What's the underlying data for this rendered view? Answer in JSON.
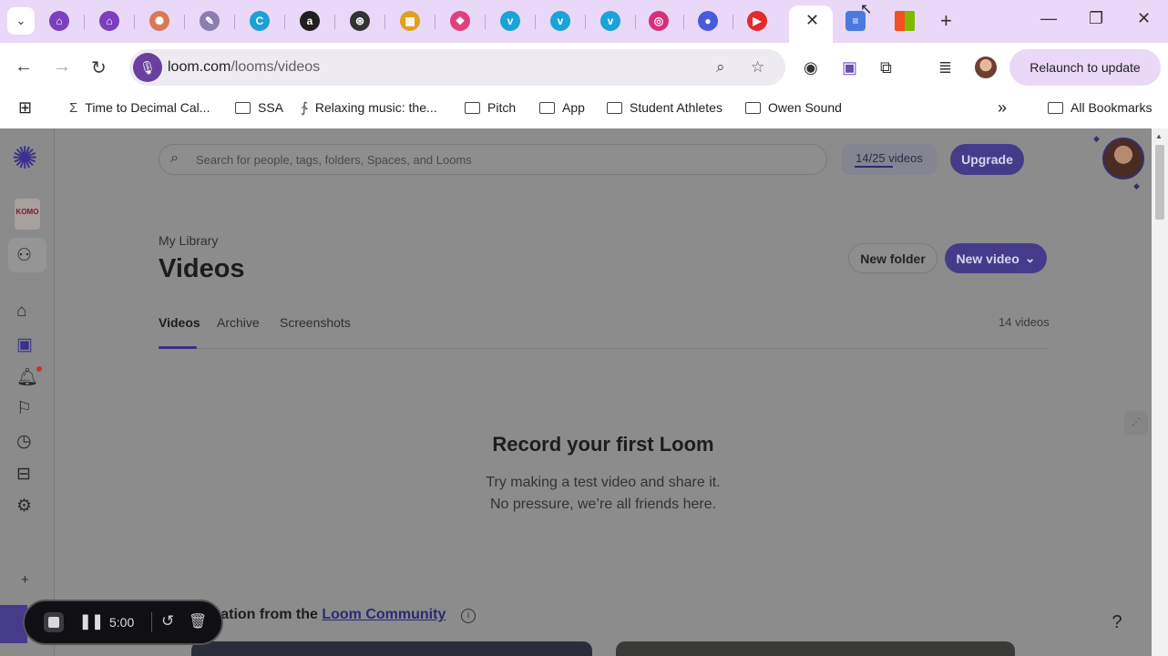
{
  "browser": {
    "tab_favicons": [
      {
        "name": "tab-favicon-1",
        "glyph": "⌂",
        "color": "#7b3fc0"
      },
      {
        "name": "tab-favicon-2",
        "glyph": "⌂",
        "color": "#7b3fc0"
      },
      {
        "name": "tab-favicon-claude",
        "glyph": "✺",
        "color": "#d97a55"
      },
      {
        "name": "tab-favicon-4",
        "glyph": "✎",
        "color": "#8a7fb0"
      },
      {
        "name": "tab-favicon-canva",
        "glyph": "C",
        "color": "#1ba0d8"
      },
      {
        "name": "tab-favicon-amazon",
        "glyph": "a",
        "color": "#1f1f1f"
      },
      {
        "name": "tab-favicon-chatgpt",
        "glyph": "⊛",
        "color": "#333333"
      },
      {
        "name": "tab-favicon-8",
        "glyph": "▦",
        "color": "#e0a020"
      },
      {
        "name": "tab-favicon-9",
        "glyph": "❖",
        "color": "#e04080"
      },
      {
        "name": "tab-favicon-vimeo-1",
        "glyph": "v",
        "color": "#19a3d8"
      },
      {
        "name": "tab-favicon-vimeo-2",
        "glyph": "v",
        "color": "#19a3d8"
      },
      {
        "name": "tab-favicon-vimeo-3",
        "glyph": "v",
        "color": "#19a3d8"
      },
      {
        "name": "tab-favicon-instagram",
        "glyph": "◎",
        "color": "#d6307a"
      },
      {
        "name": "tab-favicon-14",
        "glyph": "●",
        "color": "#4a5adf"
      },
      {
        "name": "tab-favicon-youtube",
        "glyph": "▶",
        "color": "#e52a2a"
      }
    ],
    "close_glyph": "✕",
    "new_tab_glyph": "+",
    "window": {
      "minimize": "—",
      "restore": "❐",
      "close": "✕"
    },
    "url_host": "loom.com",
    "url_path": "/looms/videos",
    "relaunch_label": "Relaunch to update",
    "bookmarks": [
      {
        "label": "Time to Decimal Cal...",
        "icon": "sigma-icon"
      },
      {
        "label": "SSA",
        "icon": "folder-icon"
      },
      {
        "label": "Relaxing music: the...",
        "icon": "music-icon"
      },
      {
        "label": "Pitch",
        "icon": "folder-icon"
      },
      {
        "label": "App",
        "icon": "folder-icon"
      },
      {
        "label": "Student Athletes",
        "icon": "folder-icon"
      },
      {
        "label": "Owen Sound",
        "icon": "folder-icon"
      }
    ],
    "all_bookmarks": "All Bookmarks",
    "overflow_glyph": "»"
  },
  "loom": {
    "search_placeholder": "Search for people, tags, folders, Spaces, and Looms",
    "quota": "14/25 videos",
    "upgrade": "Upgrade",
    "workspace_logo_text": "KOMO",
    "breadcrumb": "My Library",
    "page_title": "Videos",
    "new_folder": "New folder",
    "new_video": "New video",
    "tabs": [
      "Videos",
      "Archive",
      "Screenshots"
    ],
    "video_count": "14 videos",
    "empty_title": "Record your first Loom",
    "empty_line1": "Try making a test video and share it.",
    "empty_line2": "No pressure, we’re all friends here.",
    "community_prefix": "ration from the ",
    "community_link": "Loom Community",
    "help": "?",
    "sidebar_add": "+"
  },
  "recorder": {
    "time": "5:00"
  }
}
